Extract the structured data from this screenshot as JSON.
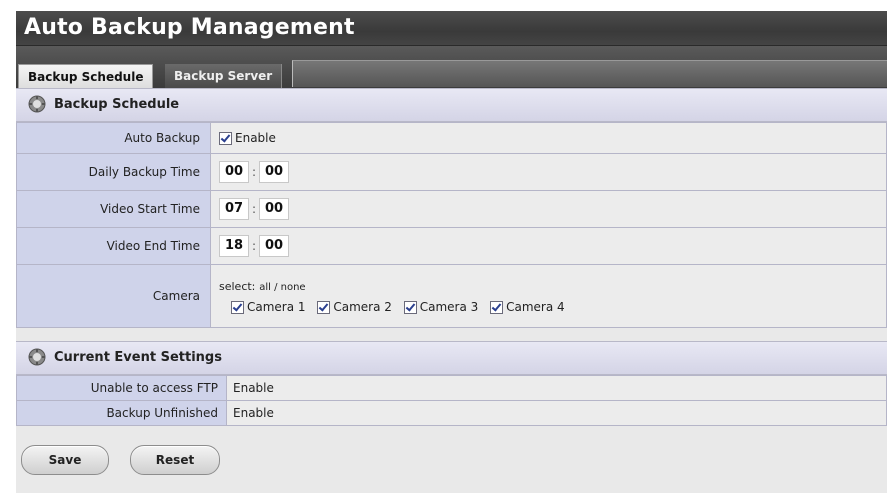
{
  "window": {
    "title": "Auto Backup Management"
  },
  "tabs": [
    {
      "label": "Backup Schedule",
      "active": true
    },
    {
      "label": "Backup Server",
      "active": false
    }
  ],
  "schedule": {
    "header": "Backup Schedule",
    "auto_backup": {
      "label": "Auto Backup",
      "checkbox_label": "Enable",
      "checked": true
    },
    "daily_backup_time": {
      "label": "Daily Backup Time",
      "hour": "00",
      "minute": "00"
    },
    "video_start_time": {
      "label": "Video Start Time",
      "hour": "07",
      "minute": "00"
    },
    "video_end_time": {
      "label": "Video End Time",
      "hour": "18",
      "minute": "00"
    },
    "camera": {
      "label": "Camera",
      "select_prefix": "select:",
      "select_all_none": "all / none",
      "items": [
        {
          "label": "Camera 1",
          "checked": true
        },
        {
          "label": "Camera 2",
          "checked": true
        },
        {
          "label": "Camera 3",
          "checked": true
        },
        {
          "label": "Camera 4",
          "checked": true
        }
      ]
    },
    "time_separator": ":"
  },
  "event_settings": {
    "header": "Current Event Settings",
    "rows": [
      {
        "label": "Unable to access FTP",
        "value": "Enable"
      },
      {
        "label": "Backup Unfinished",
        "value": "Enable"
      }
    ]
  },
  "buttons": {
    "save": "Save",
    "reset": "Reset"
  },
  "colors": {
    "title_bg": "#3f3f3f",
    "label_bg": "#cfd3ea",
    "value_bg": "#ececec",
    "section_bg": "#dcdcec"
  },
  "icons": {
    "section": "gear-icon"
  }
}
